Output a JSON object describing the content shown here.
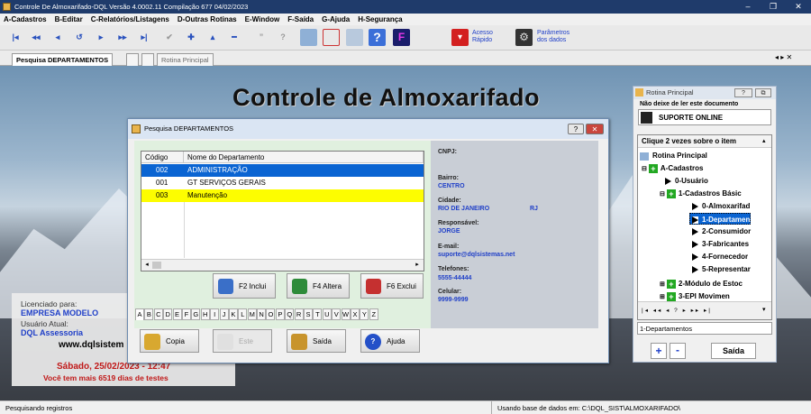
{
  "window": {
    "title": "Controle De Almoxarifado-DQL Versão  4.0002.11 Compilação 677  04/02/2023"
  },
  "menu": [
    "A-Cadastros",
    "B-Editar",
    "C-Relatórios/Listagens",
    "D-Outras Rotinas",
    "E-Window",
    "F-Saída",
    "G-Ajuda",
    "H-Segurança"
  ],
  "toolbar": {
    "acesso": "Acesso\nRápido",
    "parametros": "Parâmetros\ndos dados",
    "f_label": "F"
  },
  "tabs": {
    "pesquisa": "Pesquisa DEPARTAMENTOS",
    "rotina": "Rotina Principal"
  },
  "desktop": {
    "main_title": "Controle de Almoxarifado"
  },
  "license": {
    "label": "Licenciado para:",
    "company": "EMPRESA MODELO",
    "user_label": "Usuário Atual:",
    "user": "DQL Assessoria",
    "site": "www.dqlsistem",
    "date": "Sábado, 25/02/2023 - 12:47",
    "days": "Você tem mais 6519 dias de testes"
  },
  "dialog": {
    "title": "Pesquisa DEPARTAMENTOS",
    "columns": [
      "Código",
      "Nome do Departamento"
    ],
    "rows": [
      {
        "code": "002",
        "name": "ADMINISTRAÇÃO"
      },
      {
        "code": "001",
        "name": "GT SERVIÇOS GERAIS"
      },
      {
        "code": "003",
        "name": "Manutenção"
      }
    ],
    "actions": {
      "include": "F2 Inclui",
      "alter": "F4 Altera",
      "exclude": "F6 Exclui"
    },
    "letters": [
      "A",
      "B",
      "C",
      "D",
      "E",
      "F",
      "G",
      "H",
      "I",
      "J",
      "K",
      "L",
      "M",
      "N",
      "O",
      "P",
      "Q",
      "R",
      "S",
      "T",
      "U",
      "V",
      "W",
      "X",
      "Y",
      "Z"
    ],
    "bottom": {
      "copy": "Copia",
      "this": "Este",
      "exit": "Saída",
      "help": "Ajuda"
    },
    "detail": {
      "cnpj_label": "CNPJ:",
      "bairro_label": "Bairro:",
      "bairro": "CENTRO",
      "cidade_label": "Cidade:",
      "cidade": "RIO DE JANEIRO",
      "uf": "RJ",
      "resp_label": "Responsável:",
      "resp": "JORGE",
      "email_label": "E-mail:",
      "email": "suporte@dqlsistemas.net",
      "tel_label": "Telefones:",
      "tel": "5555-44444",
      "cel_label": "Celular:",
      "cel": "9999-9999"
    }
  },
  "rotina": {
    "title": "Rotina Principal",
    "notice": "Não deixe de ler este documento",
    "support": "SUPORTE ONLINE",
    "hint": "Clique 2 vezes sobre o item",
    "tree": [
      "Rotina Principal",
      "A-Cadastros",
      "0-Usuário",
      "1-Cadastros Básic",
      "0-Almoxarifad",
      "1-Departamen",
      "2-Consumidor",
      "3-Fabricantes",
      "4-Fornecedor",
      "5-Representar",
      "2-Módulo de Estoc",
      "3-EPI Movimen"
    ],
    "selected_text": "1-Departamentos",
    "exit": "Saída"
  },
  "status": {
    "left": "Pesquisando registros",
    "right": "Usando base de dados em: C:\\DQL_SIST\\ALMOXARIFADO\\"
  }
}
